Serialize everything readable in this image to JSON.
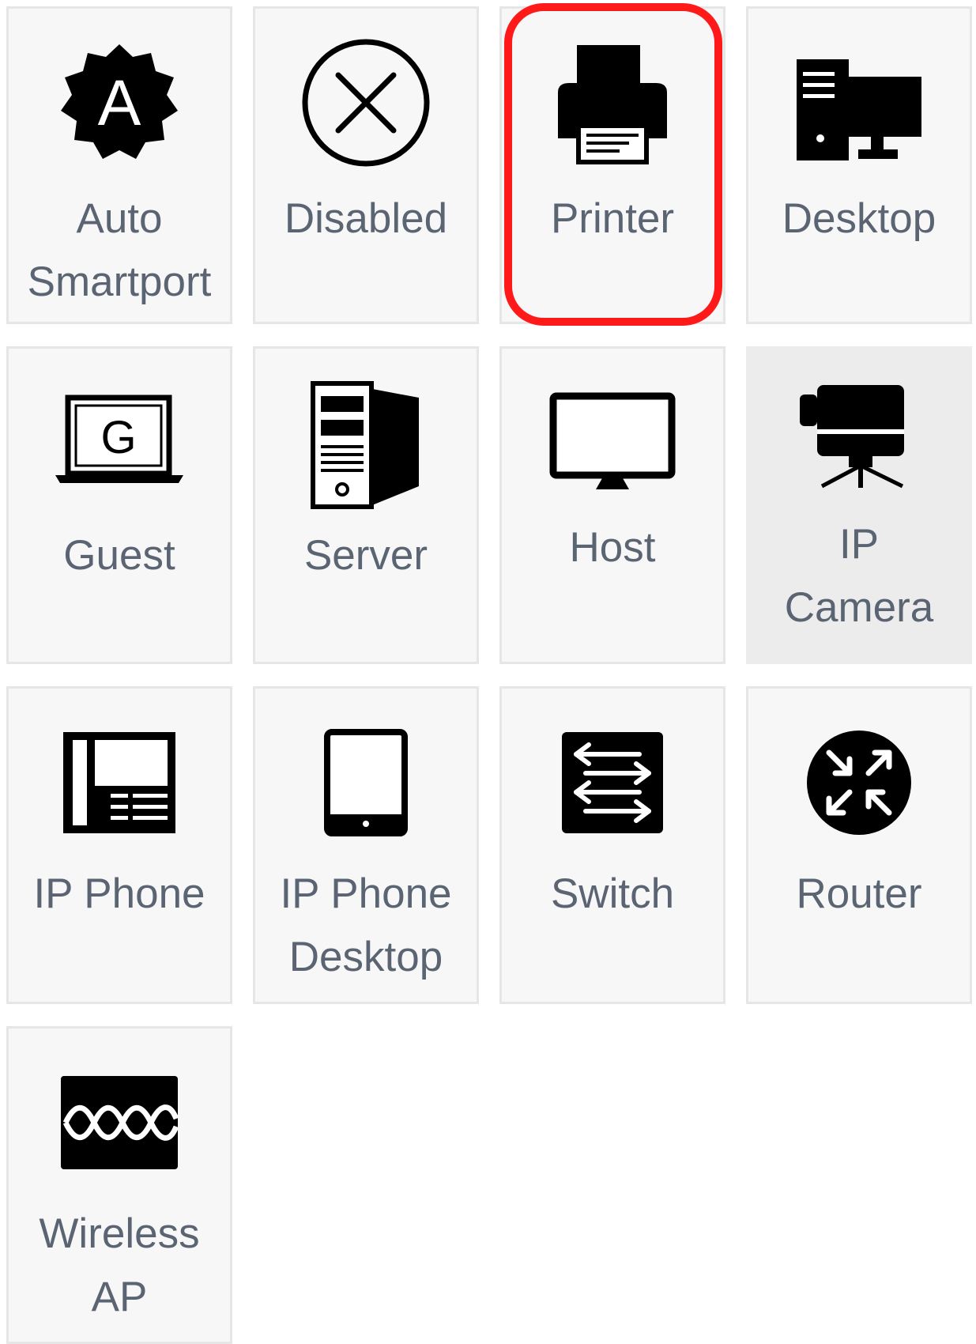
{
  "device_types": [
    {
      "id": "auto-smartport",
      "label": "Auto\nSmartport",
      "icon": "auto-smartport-badge-icon"
    },
    {
      "id": "disabled",
      "label": "Disabled",
      "icon": "circle-x-icon"
    },
    {
      "id": "printer",
      "label": "Printer",
      "icon": "printer-icon",
      "selected": true
    },
    {
      "id": "desktop",
      "label": "Desktop",
      "icon": "desktop-computer-icon"
    },
    {
      "id": "guest",
      "label": "Guest",
      "icon": "laptop-guest-icon"
    },
    {
      "id": "server",
      "label": "Server",
      "icon": "server-tower-icon"
    },
    {
      "id": "host",
      "label": "Host",
      "icon": "monitor-icon"
    },
    {
      "id": "ip-camera",
      "label": "IP\nCamera",
      "icon": "video-camera-tripod-icon",
      "hovered": true
    },
    {
      "id": "ip-phone",
      "label": "IP Phone",
      "icon": "ip-phone-icon"
    },
    {
      "id": "ip-phone-desktop",
      "label": "IP Phone\nDesktop",
      "icon": "tablet-icon"
    },
    {
      "id": "switch",
      "label": "Switch",
      "icon": "switch-arrows-icon"
    },
    {
      "id": "router",
      "label": "Router",
      "icon": "router-arrows-icon"
    },
    {
      "id": "wireless-ap",
      "label": "Wireless\nAP",
      "icon": "wireless-ap-icon"
    }
  ],
  "colors": {
    "tile_background": "#f7f7f7",
    "tile_hover_background": "#ececec",
    "tile_border": "#e6e6e6",
    "label_text": "#5a6472",
    "selection_ring": "#ff1a1a",
    "icon": "#000000"
  }
}
